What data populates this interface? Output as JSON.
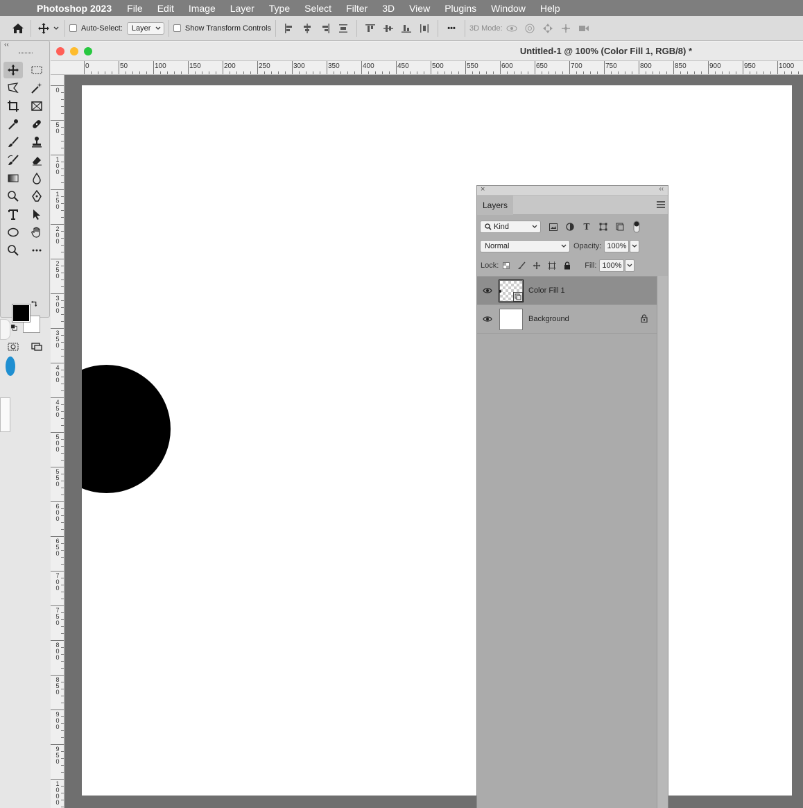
{
  "menubar": {
    "app_name": "Photoshop 2023",
    "items": [
      "File",
      "Edit",
      "Image",
      "Layer",
      "Type",
      "Select",
      "Filter",
      "3D",
      "View",
      "Plugins",
      "Window",
      "Help"
    ]
  },
  "options_bar": {
    "auto_select_label": "Auto-Select:",
    "auto_select_value": "Layer",
    "show_transform_label": "Show Transform Controls",
    "more_label": "•••",
    "mode_3d_label": "3D Mode:"
  },
  "document": {
    "title": "Untitled-1 @ 100% (Color Fill 1, RGB/8) *"
  },
  "rulers": {
    "horizontal_labels": [
      "0",
      "50",
      "100",
      "150",
      "200",
      "250",
      "300",
      "350",
      "400",
      "450",
      "500",
      "550",
      "600",
      "650",
      "700",
      "750",
      "800",
      "850",
      "900",
      "950",
      "1000"
    ],
    "vertical_labels": [
      "0",
      "50",
      "100",
      "150",
      "200",
      "250",
      "300",
      "350",
      "400",
      "450",
      "500",
      "550",
      "600",
      "650",
      "700",
      "750",
      "800",
      "850",
      "900",
      "950",
      "1000"
    ]
  },
  "tools_panel": {
    "collapse_label": "‹‹"
  },
  "layers_panel": {
    "close_label": "×",
    "collapse_label": "‹‹",
    "tab_label": "Layers",
    "filter_kind": "Kind",
    "blend_mode": "Normal",
    "opacity_label": "Opacity:",
    "opacity_value": "100%",
    "lock_label": "Lock:",
    "fill_label": "Fill:",
    "fill_value": "100%",
    "layers": [
      {
        "name": "Color Fill 1",
        "selected": true,
        "visible": true,
        "locked": false
      },
      {
        "name": "Background",
        "selected": false,
        "visible": true,
        "locked": true
      }
    ]
  },
  "colors": {
    "foreground": "#000000",
    "background": "#ffffff",
    "canvas": "#ffffff",
    "shape_fill": "#000000"
  }
}
